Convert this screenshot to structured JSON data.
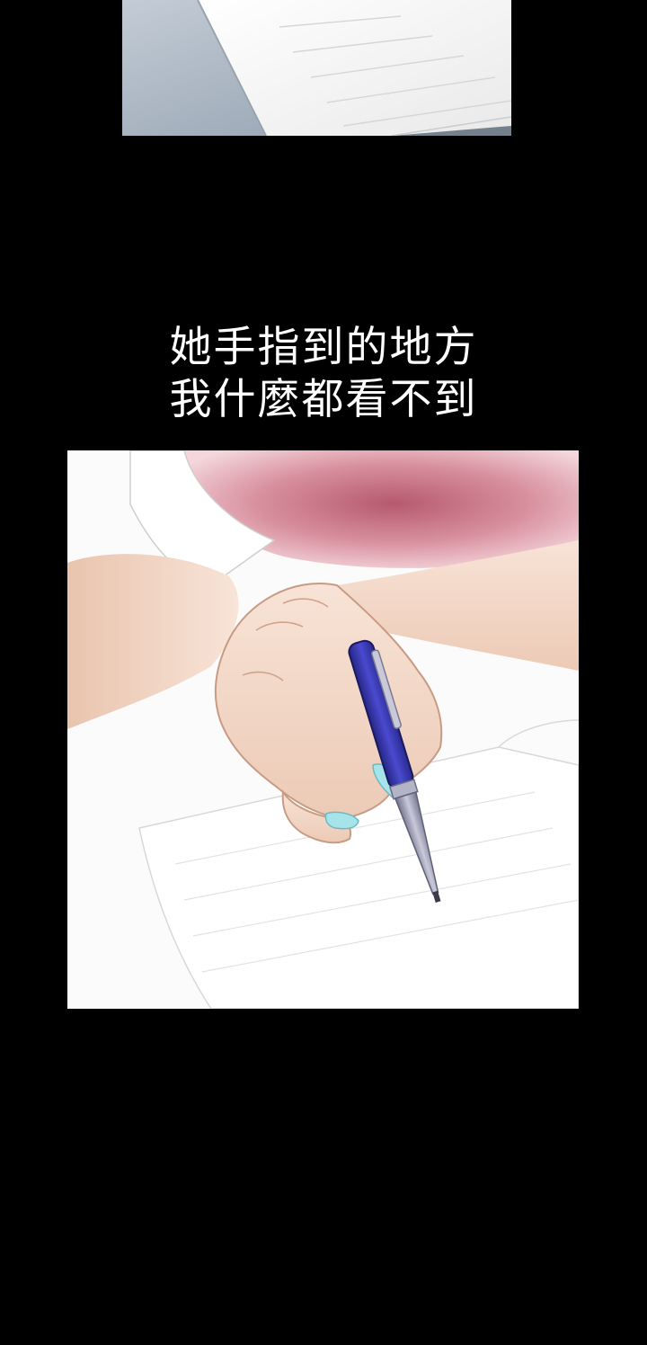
{
  "colors": {
    "gutter": "#000000",
    "caption_text": "#ffffff",
    "top_panel_wall": "#a8b4c2",
    "top_panel_paper": "#f6f6f6",
    "sheet_fabric": "#c26e80",
    "skin": "#f2d7c6",
    "pen_body": "#3c3cb4",
    "pen_tip": "#8e8ea4",
    "nail_polish": "#a6e4ea"
  },
  "narration": {
    "line_1": "她手指到的地方",
    "line_2": "我什麼都看不到"
  }
}
